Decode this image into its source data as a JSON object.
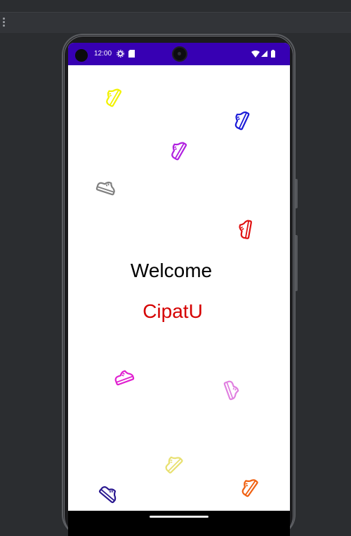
{
  "ide": {
    "menu_icon": "kebab-menu-icon"
  },
  "status_bar": {
    "time": "12:00",
    "icons": [
      "settings-gear-icon",
      "sd-card-icon",
      "wifi-icon",
      "cellular-signal-icon",
      "battery-icon"
    ],
    "background": "#3700b3"
  },
  "app": {
    "welcome_text": "Welcome",
    "brand_text": "CipatU",
    "brand_color": "#d50000",
    "decorations": [
      {
        "icon": "sneaker-icon",
        "color": "#f2f200"
      },
      {
        "icon": "sneaker-icon",
        "color": "#1a1ad8"
      },
      {
        "icon": "sneaker-icon",
        "color": "#b020e0"
      },
      {
        "icon": "sneaker-icon",
        "color": "#808080"
      },
      {
        "icon": "sneaker-icon",
        "color": "#e01010"
      },
      {
        "icon": "sneaker-icon",
        "color": "#e020d0"
      },
      {
        "icon": "sneaker-icon",
        "color": "#e080e0"
      },
      {
        "icon": "sneaker-icon",
        "color": "#e8e070"
      },
      {
        "icon": "sneaker-icon",
        "color": "#2a1890"
      },
      {
        "icon": "sneaker-icon",
        "color": "#f06010"
      }
    ]
  },
  "navigation": {
    "gesture_handle": "home-gesture-handle"
  }
}
